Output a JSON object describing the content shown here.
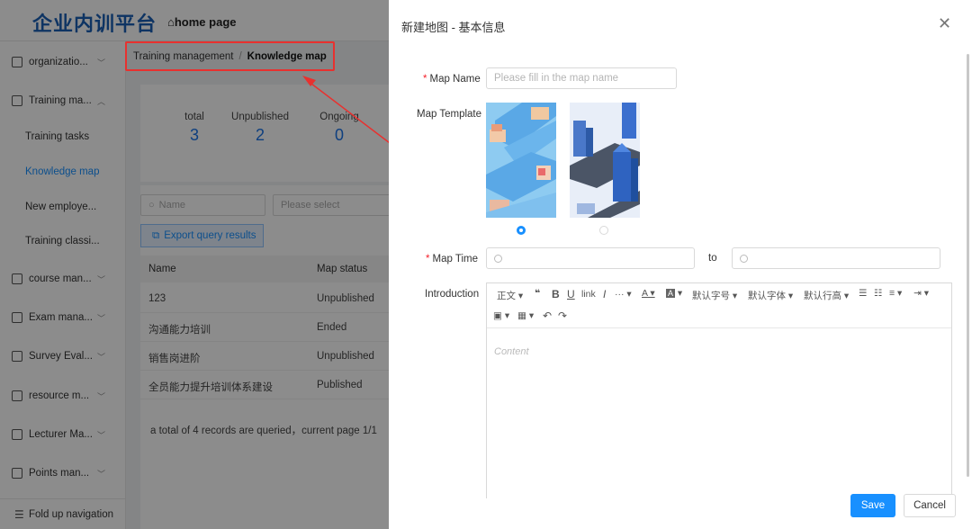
{
  "app": {
    "logo": "企业内训平台",
    "home_link": "home page"
  },
  "sidebar": {
    "items": [
      {
        "label": "organizatio...",
        "icon": "org-icon"
      },
      {
        "label": "Training ma...",
        "icon": "training-icon"
      },
      {
        "label": "course man...",
        "icon": "course-icon"
      },
      {
        "label": "Exam mana...",
        "icon": "exam-icon"
      },
      {
        "label": "Survey Eval...",
        "icon": "survey-icon"
      },
      {
        "label": "resource m...",
        "icon": "resource-icon"
      },
      {
        "label": "Lecturer Ma...",
        "icon": "lecturer-icon"
      },
      {
        "label": "Points man...",
        "icon": "points-icon"
      }
    ],
    "subitems": [
      "Training tasks",
      "Knowledge map",
      "New employe...",
      "Training classi..."
    ],
    "active_sub": "Knowledge map",
    "footer": "Fold up navigation"
  },
  "breadcrumb": {
    "parent": "Training management",
    "separator": "/",
    "current": "Knowledge map"
  },
  "stats": [
    {
      "label": "total",
      "value": "3"
    },
    {
      "label": "Unpublished",
      "value": "2"
    },
    {
      "label": "Ongoing",
      "value": "0"
    }
  ],
  "filters": {
    "name_placeholder": "Name",
    "status_placeholder": "Please select"
  },
  "export_label": "Export query results",
  "table": {
    "headers": [
      "Name",
      "Map status"
    ],
    "rows": [
      [
        "123",
        "Unpublished"
      ],
      [
        "沟通能力培训",
        "Ended"
      ],
      [
        "销售岗进阶",
        "Unpublished"
      ],
      [
        "全员能力提升培训体系建设",
        "Published"
      ]
    ],
    "pageinfo": "a total of 4 records are queried，current page 1/1"
  },
  "drawer": {
    "title": "新建地图 - 基本信息",
    "map_name_label": "Map Name",
    "map_name_placeholder": "Please fill in the map name",
    "map_template_label": "Map Template",
    "selected_template": 1,
    "map_time_label": "Map Time",
    "to_label": "to",
    "introduction_label": "Introduction",
    "toolbar": {
      "paragraph": "正文",
      "quote": "❝",
      "bold": "B",
      "underline": "U",
      "link": "link",
      "italic": "I",
      "more": "···",
      "font_color": "A",
      "bg_color": "A",
      "font_size": "默认字号",
      "font_family": "默认字体",
      "line_height": "默认行高"
    },
    "content_placeholder": "Content",
    "save": "Save",
    "cancel": "Cancel"
  },
  "colors": {
    "accent": "#1890ff",
    "highlight": "#e8312f",
    "stat_number": "#1a73e8"
  }
}
